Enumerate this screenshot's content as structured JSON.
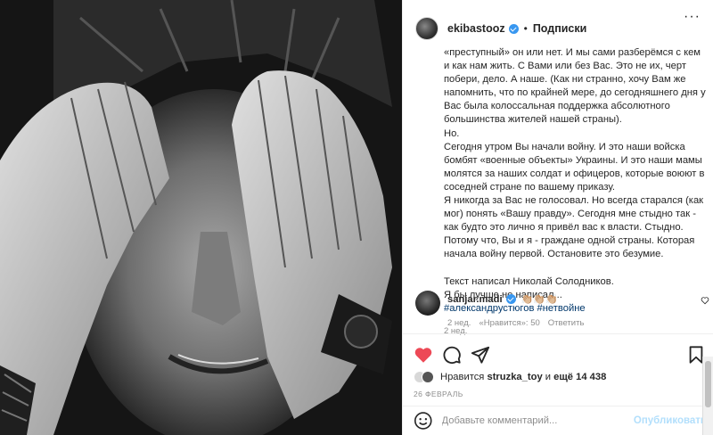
{
  "post": {
    "author": "ekibastooz",
    "follow_label": "Подписки",
    "dot": "•",
    "more_label": "···",
    "caption_lines": [
      "«преступный» он или нет. И мы сами разберёмся с кем и как нам жить. С Вами или без Вас. Это не их, черт побери, дело. А наше. (Как ни странно, хочу Вам же напомнить, что по крайней мере, до сегодняшнего дня у Вас была колоссальная поддержка абсолютного большинства жителей нашей страны).",
      "Но.",
      "Сегодня утром Вы начали войну. И это наши войска бомбят «военные объекты» Украины. И это наши мамы молятся за наших солдат и офицеров, которые воюют в соседней стране по вашему приказу.",
      "Я никогда за Вас не голосовал. Но всегда старался (как мог) понять «Вашу правду». Сегодня мне стыдно так - как будто это лично я привёл вас к власти. Стыдно. Потому что, Вы и я - граждане одной страны. Которая начала войну первой. Остановите это безумие."
    ],
    "caption_after": [
      "Текст написал Николай Солодников.",
      "Я бы лучше не написал..."
    ],
    "hashtags": [
      "#александрустюгов",
      "#нетвойне"
    ],
    "caption_time": "2 нед.",
    "comment": {
      "author": "sanjar.madi",
      "text": "👏🏼👏🏼👏🏼",
      "time": "2 нед.",
      "likes": "«Нравится»: 50",
      "reply": "Ответить"
    },
    "likes_prefix": "Нравится ",
    "likes_user": "struzka_toy",
    "likes_middle": " и ",
    "likes_count": "ещё 14 438",
    "date": "26 ФЕВРАЛЬ",
    "comment_placeholder": "Добавьте комментарий...",
    "publish_label": "Опубликовать"
  },
  "colors": {
    "heart": "#ed4956",
    "link": "#00376b",
    "verified": "#3897f0",
    "publish_disabled": "#b2dffc",
    "muted": "#8e8e8e"
  }
}
